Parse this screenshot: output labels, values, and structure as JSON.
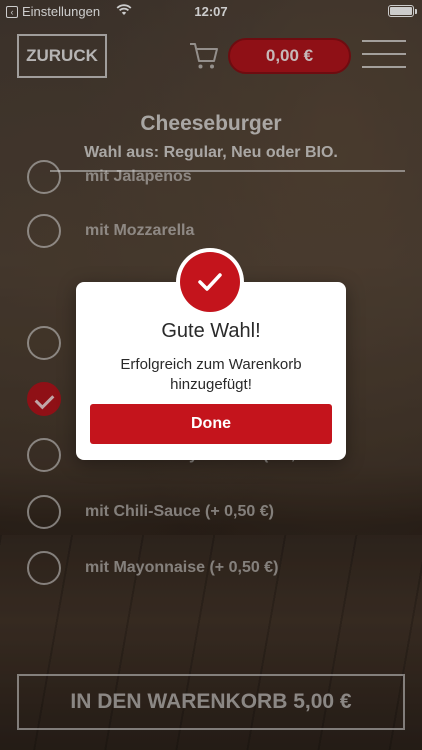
{
  "statusbar": {
    "back_app": "Einstellungen",
    "time": "12:07"
  },
  "header": {
    "back_label": "ZURUCK",
    "cart_total": "0,00 €",
    "title": "Cheeseburger",
    "subtitle": "Wahl aus: Regular, Neu oder BIO."
  },
  "options": [
    {
      "label": "mit Jalapenos",
      "checked": false
    },
    {
      "label": "mit Mozzarella",
      "checked": false
    },
    {
      "label": "",
      "checked": false
    },
    {
      "label": "",
      "checked": true
    },
    {
      "label": "mit Trüffel Mayonnaise (+ 0,50…",
      "checked": false
    },
    {
      "label": "mit Chili-Sauce (+ 0,50 €)",
      "checked": false
    },
    {
      "label": "mit Mayonnaise (+ 0,50 €)",
      "checked": false
    }
  ],
  "footer": {
    "add_to_cart": "IN DEN WARENKORB 5,00 €"
  },
  "modal": {
    "title": "Gute Wahl!",
    "message": "Erfolgreich zum Warenkorb hinzugefügt!",
    "done_label": "Done"
  },
  "colors": {
    "accent": "#c4141c",
    "price_pill": "#b3141c"
  },
  "icons": {
    "cart": "cart-icon",
    "menu": "hamburger-menu-icon",
    "success": "checkmark-icon"
  }
}
